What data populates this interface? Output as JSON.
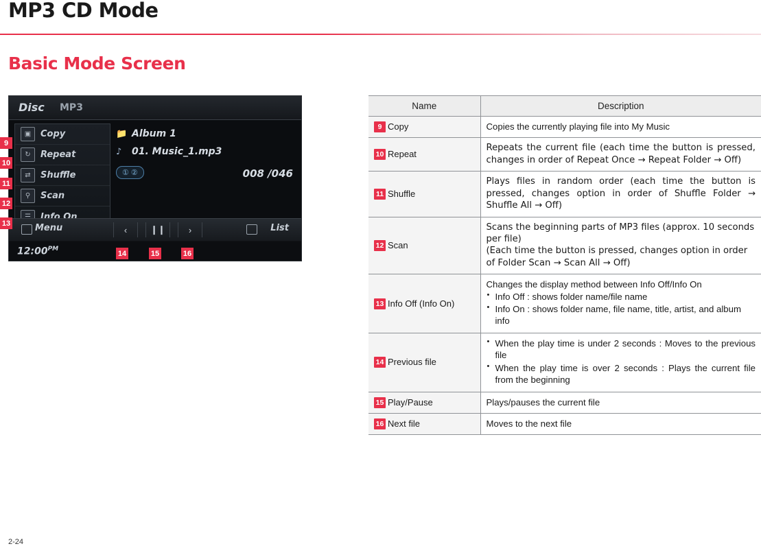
{
  "header": {
    "title": "MP3 CD Mode",
    "section": "Basic Mode Screen"
  },
  "screen": {
    "disc_label": "Disc",
    "format_label": "MP3",
    "menu_items": [
      {
        "icon": "copy-icon",
        "label": "Copy"
      },
      {
        "icon": "repeat-icon",
        "label": "Repeat"
      },
      {
        "icon": "shuffle-icon",
        "label": "Shuffle"
      },
      {
        "icon": "scan-icon",
        "label": "Scan"
      },
      {
        "icon": "info-icon",
        "label": "Info On"
      }
    ],
    "folder": "Album 1",
    "track": "01. Music_1.mp3",
    "badge": "① ②",
    "counter": "008 /046",
    "menu_button": "Menu",
    "list_button": "List",
    "clock": "12:00",
    "clock_suffix": "PM",
    "prev_symbol": "‹",
    "pause_symbol": "❙❙",
    "next_symbol": "›",
    "callouts": [
      "9",
      "10",
      "11",
      "12",
      "13",
      "14",
      "15",
      "16"
    ]
  },
  "table": {
    "columns": [
      "Name",
      "Description"
    ],
    "rows": [
      {
        "num": "9",
        "name": "Copy",
        "desc_lines": [
          "Copies the currently playing file into My Music"
        ],
        "style": "plain"
      },
      {
        "num": "10",
        "name": "Repeat",
        "desc_lines": [
          "Repeats the current file (each time the button is pressed, changes in order of Repeat Once → Repeat Folder → Off)"
        ],
        "style": "soft"
      },
      {
        "num": "11",
        "name": "Shuffle",
        "desc_lines": [
          "Plays files in random order (each time the button is pressed, changes option in order of Shuffle Folder → Shuffle All → Off)"
        ],
        "style": "soft"
      },
      {
        "num": "12",
        "name": "Scan",
        "desc_lines": [
          "Scans the beginning parts of MP3 files (approx. 10 seconds per file)",
          "(Each time the button is pressed, changes option in order of Folder Scan → Scan All → Off)"
        ],
        "style": "soft"
      },
      {
        "num": "13",
        "name": "Info Off (Info On)",
        "desc_heading": "Changes the display method between Info Off/Info On",
        "bullets": [
          "Info Off : shows folder name/file name",
          "Info On : shows folder name, file name, title, artist, and album info"
        ],
        "style": "plain"
      },
      {
        "num": "14",
        "name": "Previous file",
        "bullets": [
          "When the play time is under 2 seconds : Moves to the previous file",
          "When the play time is over 2 seconds : Plays the current file from the beginning"
        ],
        "style": "plain"
      },
      {
        "num": "15",
        "name": "Play/Pause",
        "desc_lines": [
          "Plays/pauses the current file"
        ],
        "style": "plain"
      },
      {
        "num": "16",
        "name": "Next file",
        "desc_lines": [
          "Moves to the next file"
        ],
        "style": "plain"
      }
    ]
  },
  "footer": {
    "page_number": "2-24"
  },
  "colors": {
    "accent": "#e8304a",
    "header_rule": "#e8304a",
    "table_header_bg": "#ededed",
    "name_cell_bg": "#f4f4f4"
  }
}
